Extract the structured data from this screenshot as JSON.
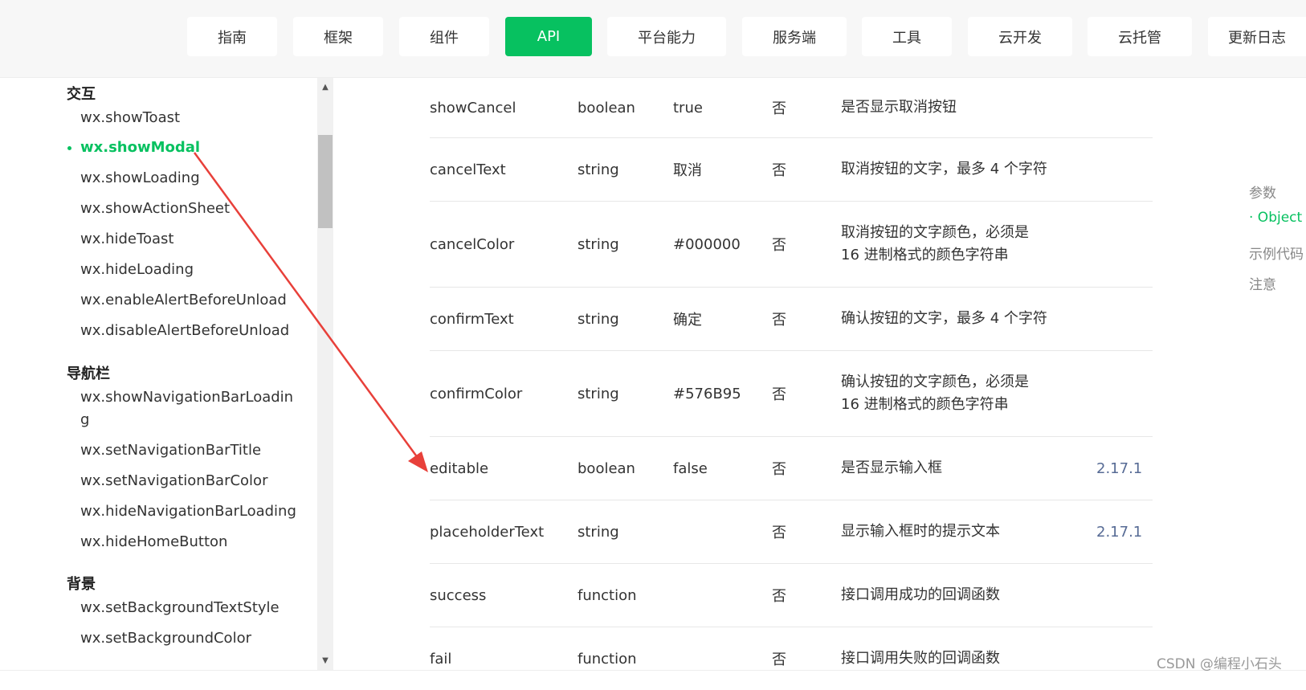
{
  "nav": {
    "items": [
      {
        "label": "指南"
      },
      {
        "label": "框架"
      },
      {
        "label": "组件"
      },
      {
        "label": "API"
      },
      {
        "label": "平台能力"
      },
      {
        "label": "服务端"
      },
      {
        "label": "工具"
      },
      {
        "label": "云开发"
      },
      {
        "label": "云托管"
      },
      {
        "label": "更新日志"
      }
    ],
    "active": "API",
    "accent_color": "#07c160"
  },
  "sidebar": {
    "groups": [
      {
        "title": "交互",
        "items": [
          {
            "label": "wx.showToast"
          },
          {
            "label": "wx.showModal",
            "active": true
          },
          {
            "label": "wx.showLoading"
          },
          {
            "label": "wx.showActionSheet"
          },
          {
            "label": "wx.hideToast"
          },
          {
            "label": "wx.hideLoading"
          },
          {
            "label": "wx.enableAlertBeforeUnload"
          },
          {
            "label": "wx.disableAlertBeforeUnload"
          }
        ]
      },
      {
        "title": "导航栏",
        "items": [
          {
            "label": "wx.showNavigationBarLoadin",
            "cont": "g"
          },
          {
            "label": "wx.setNavigationBarTitle"
          },
          {
            "label": "wx.setNavigationBarColor"
          },
          {
            "label": "wx.hideNavigationBarLoading"
          },
          {
            "label": "wx.hideHomeButton"
          }
        ]
      },
      {
        "title": "背景",
        "items": [
          {
            "label": "wx.setBackgroundTextStyle"
          },
          {
            "label": "wx.setBackgroundColor"
          }
        ]
      }
    ]
  },
  "table": {
    "rows": [
      {
        "name": "showCancel",
        "type": "boolean",
        "default": "true",
        "required": "否",
        "desc": "是否显示取消按钮",
        "version": ""
      },
      {
        "name": "cancelText",
        "type": "string",
        "default": "取消",
        "required": "否",
        "desc": "取消按钮的文字，最多 4 个字符",
        "version": ""
      },
      {
        "name": "cancelColor",
        "type": "string",
        "default": "#000000",
        "required": "否",
        "desc": "取消按钮的文字颜色，必须是 16 进制格式的颜色字符串",
        "version": ""
      },
      {
        "name": "confirmText",
        "type": "string",
        "default": "确定",
        "required": "否",
        "desc": "确认按钮的文字，最多 4 个字符",
        "version": ""
      },
      {
        "name": "confirmColor",
        "type": "string",
        "default": "#576B95",
        "required": "否",
        "desc": "确认按钮的文字颜色，必须是 16 进制格式的颜色字符串",
        "version": ""
      },
      {
        "name": "editable",
        "type": "boolean",
        "default": "false",
        "required": "否",
        "desc": "是否显示输入框",
        "version": "2.17.1"
      },
      {
        "name": "placeholderText",
        "type": "string",
        "default": "",
        "required": "否",
        "desc": "显示输入框时的提示文本",
        "version": "2.17.1"
      },
      {
        "name": "success",
        "type": "function",
        "default": "",
        "required": "否",
        "desc": "接口调用成功的回调函数",
        "version": ""
      },
      {
        "name": "fail",
        "type": "function",
        "default": "",
        "required": "否",
        "desc": "接口调用失败的回调函数",
        "version": ""
      }
    ],
    "version_color": "#576b95"
  },
  "toc": {
    "items": [
      {
        "label": "参数"
      },
      {
        "label": "· Object",
        "active": true
      },
      {
        "label": "示例代码"
      },
      {
        "label": "注意"
      }
    ]
  },
  "annotation": {
    "arrow_color": "#e8403a"
  },
  "watermark": "CSDN @编程小石头"
}
